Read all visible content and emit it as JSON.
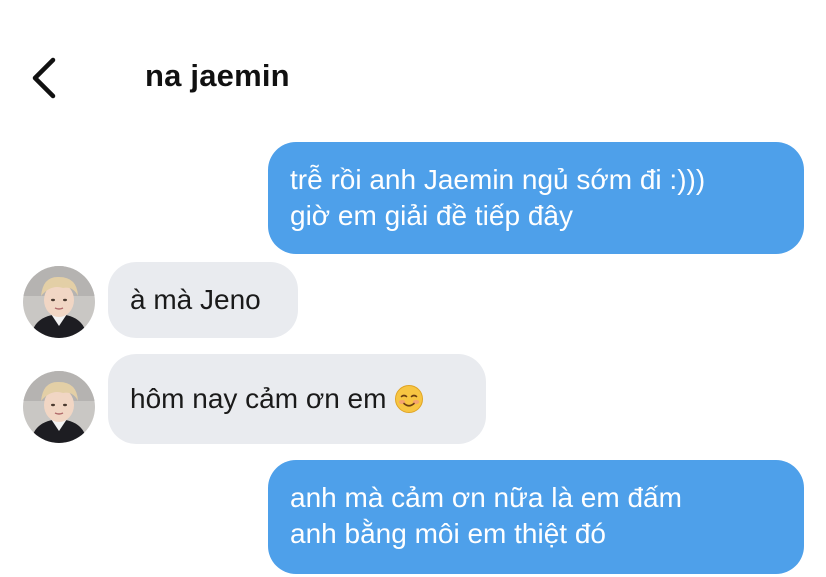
{
  "header": {
    "back_icon": "chevron-left-icon",
    "title": "na jaemin"
  },
  "colors": {
    "outgoing_bubble": "#4ea0ea",
    "incoming_bubble": "#e9ebef",
    "background": "#ffffff"
  },
  "messages": [
    {
      "direction": "outgoing",
      "lines": [
        "trễ rồi anh Jaemin ngủ sớm đi :)))",
        "giờ em giải đề tiếp đây"
      ]
    },
    {
      "direction": "incoming",
      "text": "à mà Jeno"
    },
    {
      "direction": "incoming",
      "text": "hôm nay cảm ơn em",
      "emoji": "smiling-blush-emoji-icon"
    },
    {
      "direction": "outgoing",
      "lines": [
        "anh mà cảm ơn nữa là em đấm",
        "anh bằng môi em thiệt đó"
      ]
    }
  ]
}
